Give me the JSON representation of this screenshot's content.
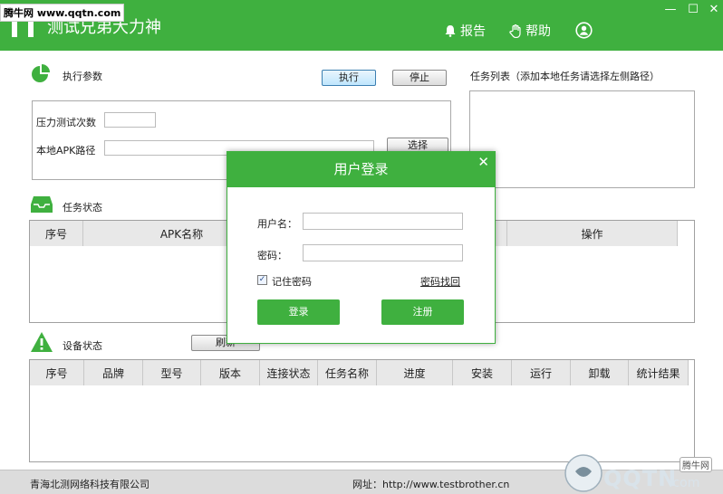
{
  "window": {
    "title": "测试兄弟大力神",
    "watermark": "腾牛网 www.qqtn.com",
    "report_label": "报告",
    "help_label": "帮助",
    "minimize": "—",
    "maximize": "☐",
    "close": "✕"
  },
  "params": {
    "title": "执行参数",
    "execute_label": "执行",
    "stop_label": "停止",
    "stress_label": "压力测试次数",
    "stress_value": "",
    "apk_path_label": "本地APK路径",
    "apk_path_value": "",
    "browse_label": "选择"
  },
  "task_list": {
    "title": "任务列表（添加本地任务请选择左侧路径）"
  },
  "task_status": {
    "title": "任务状态",
    "columns": [
      "序号",
      "APK名称",
      "",
      "操作"
    ]
  },
  "device_status": {
    "title": "设备状态",
    "refresh_label": "刷新",
    "columns": [
      "序号",
      "品牌",
      "型号",
      "版本",
      "连接状态",
      "任务名称",
      "进度",
      "安装",
      "运行",
      "卸载",
      "统计结果"
    ]
  },
  "status_bar": {
    "company": "青海北测网络科技有限公司",
    "website": "网址：http://www.testbrother.cn"
  },
  "login_dialog": {
    "title": "用户登录",
    "close": "✕",
    "username_label": "用户名：",
    "username_value": "",
    "password_label": "密码：",
    "password_value": "",
    "remember_label": "记住密码",
    "remember_checked": true,
    "recover_label": "密码找回",
    "login_label": "登录",
    "register_label": "注册"
  },
  "watermark_logo": {
    "brand": "QQTN",
    "suffix": ".com",
    "badge": "腾牛网"
  },
  "colors": {
    "brand": "#3fb03f",
    "header_row": "#e8e8e8",
    "status_bar": "#dcdcdc"
  }
}
